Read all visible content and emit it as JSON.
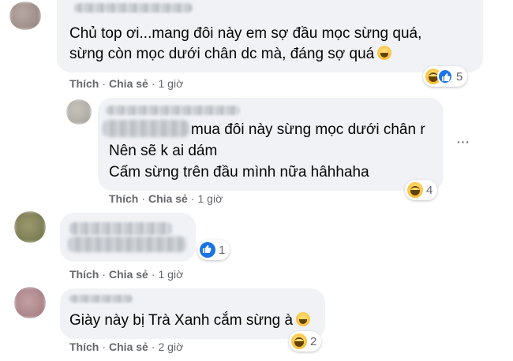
{
  "comments": [
    {
      "lines": [
        "Chủ top ơi...mang đôi này em sợ đầu mọc sừng quá,",
        "sừng còn mọc dưới chân dc mà, đáng sợ quá"
      ],
      "actions": {
        "like": "Thích",
        "share": "Chia sẻ",
        "time": "1 giờ"
      },
      "reactions": {
        "icons": [
          "haha-icon",
          "like-icon"
        ],
        "count": "5"
      }
    },
    {
      "lines": [
        "mua đôi này sừng mọc dưới chân r",
        "Nên sẽ k ai dám",
        "Cấm sừng trên đầu mình nữa hâhhaha"
      ],
      "actions": {
        "like": "Thích",
        "share": "Chia sẻ",
        "time": "1 giờ"
      },
      "reactions": {
        "icons": [
          "haha-icon"
        ],
        "count": "4"
      }
    },
    {
      "lines": [],
      "actions": {
        "like": "Thích",
        "share": "Chia sẻ",
        "time": "1 giờ"
      },
      "reactions": {
        "icons": [
          "like-icon"
        ],
        "count": "1"
      }
    },
    {
      "lines": [
        "Giày này bị Trà Xanh cắm sừng à"
      ],
      "actions": {
        "like": "Thích",
        "share": "Chia sẻ",
        "time": "2 giờ"
      },
      "reactions": {
        "icons": [
          "haha-icon"
        ],
        "count": "2"
      }
    }
  ],
  "separator": "·",
  "colors": {
    "bubble": "#f0f2f5",
    "meta": "#65676b",
    "like_blue": "#1b74e4",
    "haha_yellow": "#f7b125"
  }
}
